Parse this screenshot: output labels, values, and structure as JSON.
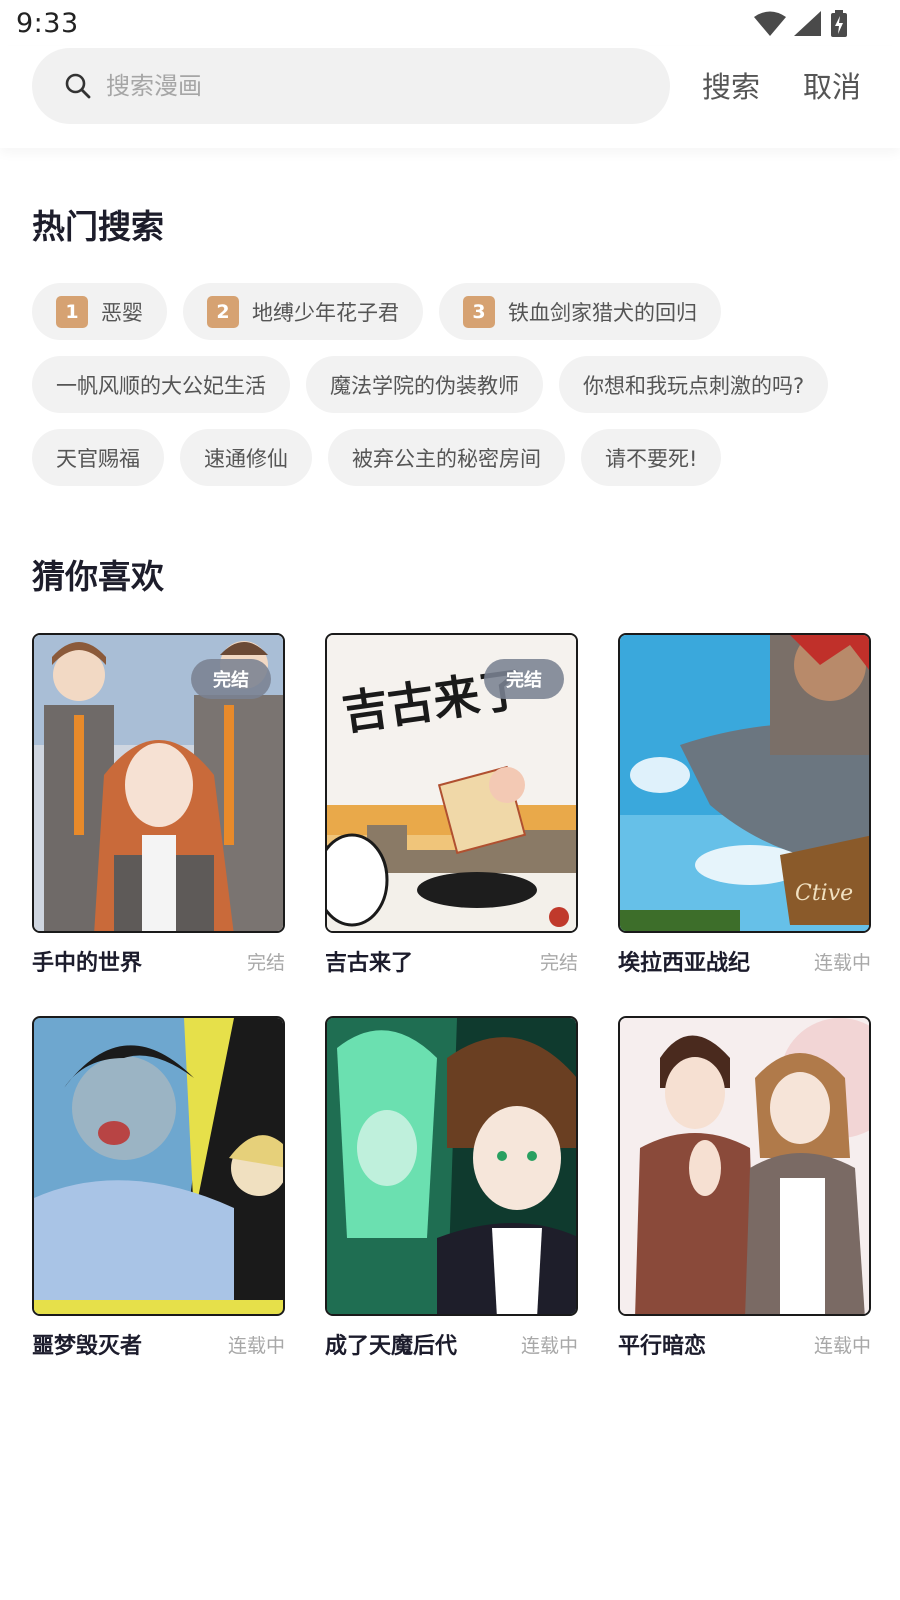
{
  "status_bar": {
    "time": "9:33",
    "icons": [
      "wifi-icon",
      "signal-icon",
      "battery-charging-icon"
    ]
  },
  "search": {
    "placeholder": "搜索漫画",
    "search_label": "搜索",
    "cancel_label": "取消"
  },
  "hot_search": {
    "title": "热门搜索",
    "rows": [
      [
        {
          "rank": "1",
          "label": "恶婴"
        },
        {
          "rank": "2",
          "label": "地缚少年花子君"
        },
        {
          "rank": "3",
          "label": "铁血剑家猎犬的回归"
        }
      ],
      [
        {
          "label": "一帆风顺的大公妃生活"
        },
        {
          "label": "魔法学院的伪装教师"
        },
        {
          "label": "你想和我玩点刺激的吗?"
        }
      ],
      [
        {
          "label": "天官赐福"
        },
        {
          "label": "速通修仙"
        },
        {
          "label": "被弃公主的秘密房间"
        },
        {
          "label": "请不要死!"
        }
      ]
    ]
  },
  "guess": {
    "title": "猜你喜欢",
    "comics": [
      {
        "title": "手中的世界",
        "status": "完结",
        "badge": "完结"
      },
      {
        "title": "吉古来了",
        "status": "完结",
        "badge": "完结",
        "cover_text": "吉古来了"
      },
      {
        "title": "埃拉西亚战纪",
        "status": "连载中"
      },
      {
        "title": "噩梦毁灭者",
        "status": "连载中"
      },
      {
        "title": "成了天魔后代",
        "status": "连载中"
      },
      {
        "title": "平行暗恋",
        "status": "连载中"
      }
    ]
  },
  "colors": {
    "rank_badge": "#d6a272",
    "tag_bg": "#f2f2f2",
    "search_bg": "#f1f1f1",
    "badge_bg": "#7a8292"
  }
}
